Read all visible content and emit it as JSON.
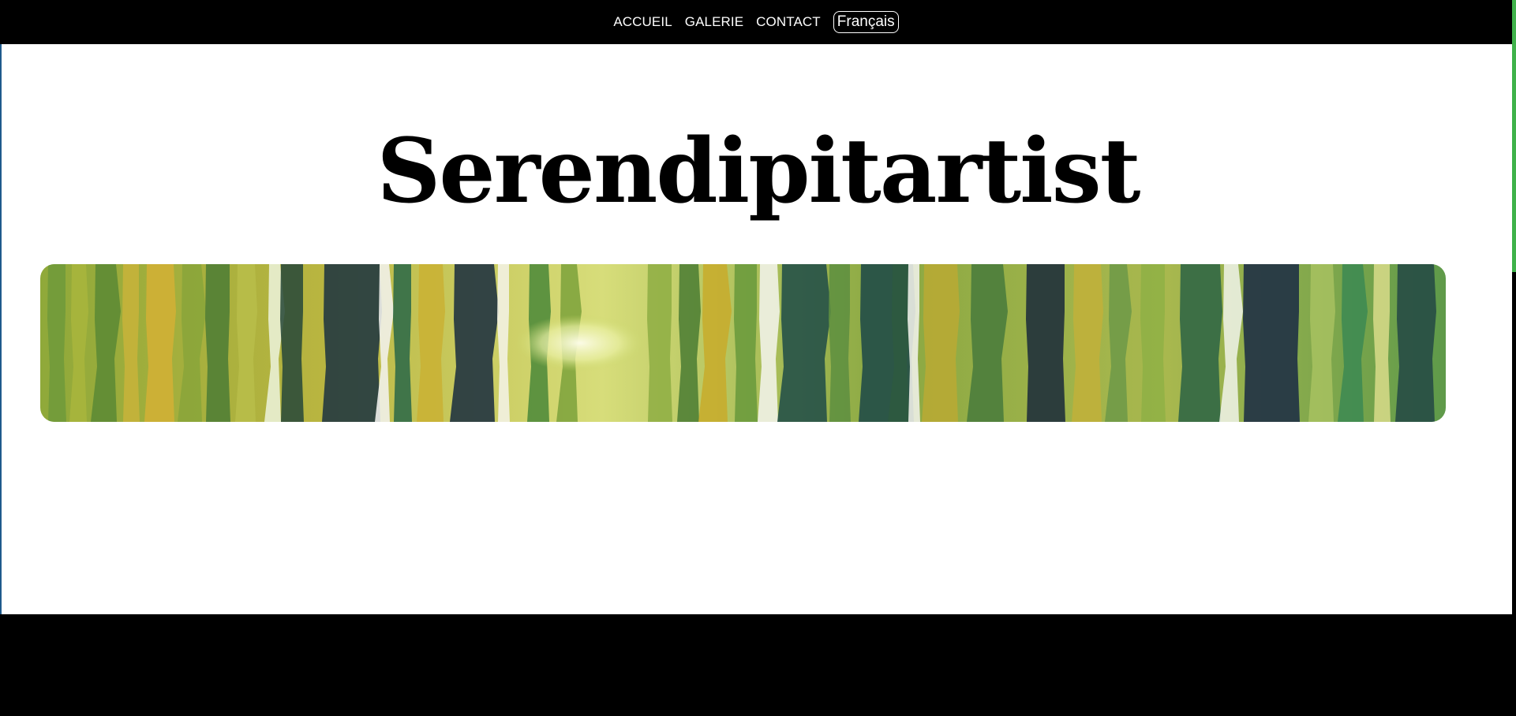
{
  "nav": {
    "links": [
      {
        "label": "ACCUEIL"
      },
      {
        "label": "GALERIE"
      },
      {
        "label": "CONTACT"
      }
    ],
    "language": "Français"
  },
  "hero": {
    "title": "Serendipitartist",
    "banner_icon": "watercolor-forest-painting"
  },
  "colors": {
    "nav_bg": "#000000",
    "page_bg": "#ffffff",
    "scroll_accent": "#3fb24a"
  }
}
